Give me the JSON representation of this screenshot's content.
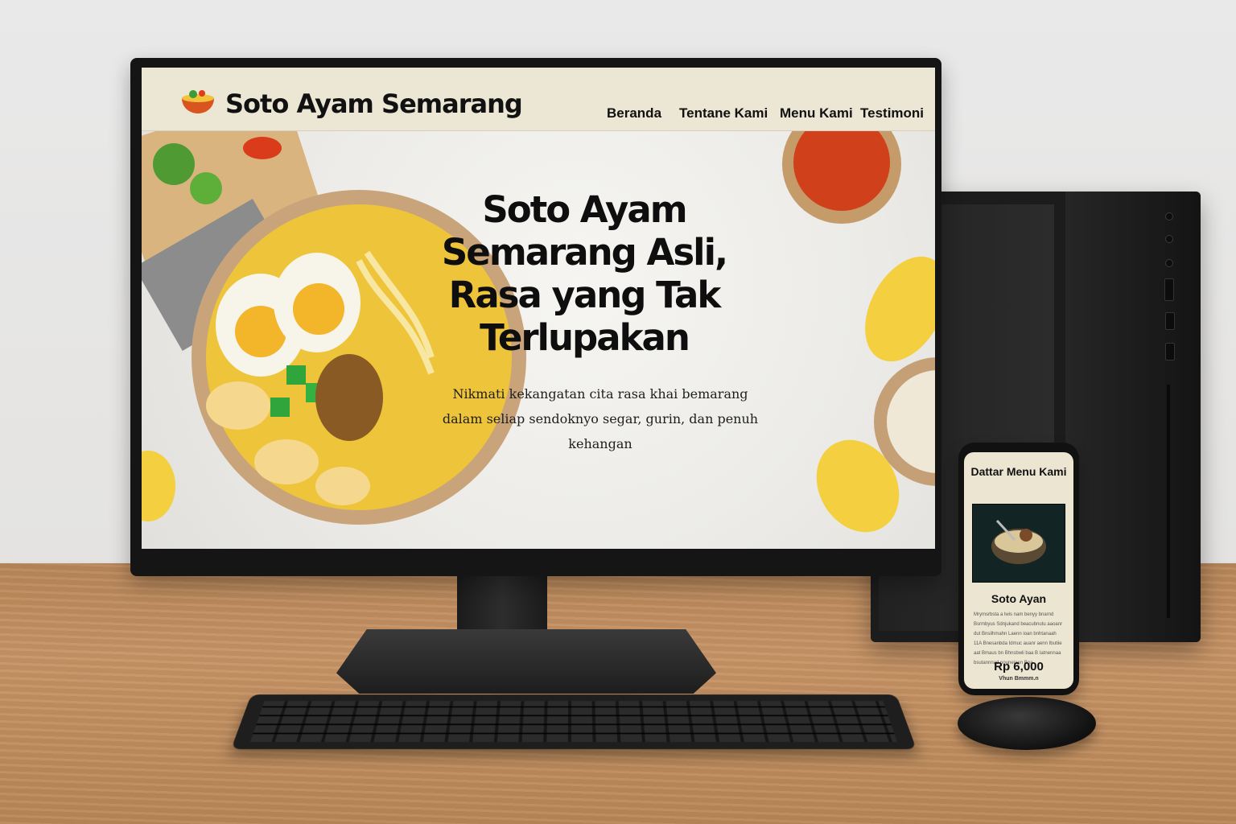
{
  "site": {
    "brand": "Soto Ayam Semarang",
    "nav": [
      "Beranda",
      "Tentane Kami",
      "Menu Kami",
      "Testimoni"
    ],
    "hero": {
      "title_lines": [
        "Soto Ayam",
        "Semarang Asli,",
        "Rasa yang Tak",
        "Terlupakan"
      ],
      "subtitle_lines": [
        "Nikmati kekangatan cita rasa khai bemarang",
        "dalam seliap sendoknyo segar, gurin, dan penuh",
        "kehangan"
      ]
    }
  },
  "phone": {
    "title": "Dattar Menu Kami",
    "item_name": "Soto Ayan",
    "description": "Mrymsrbsta a lwis nam benyy bnarnd Bsrmbyus Sdnjukand beacubnutu aaoanr dut Bnsilhmahn Laenn ioan bnhtanaah 11A Bnesanbda Idmuc auanr aenn Ibutiie aat Bmaus bn Bhnsbwli baa B Iatnennaa bsutannnad nouneiaen Bpa",
    "price": "Rp 6,000",
    "footnote": "Vhun Bmmm.n"
  },
  "colors": {
    "nav_bg": "#ece6d5",
    "text": "#111111",
    "broth": "#f0c93c"
  }
}
